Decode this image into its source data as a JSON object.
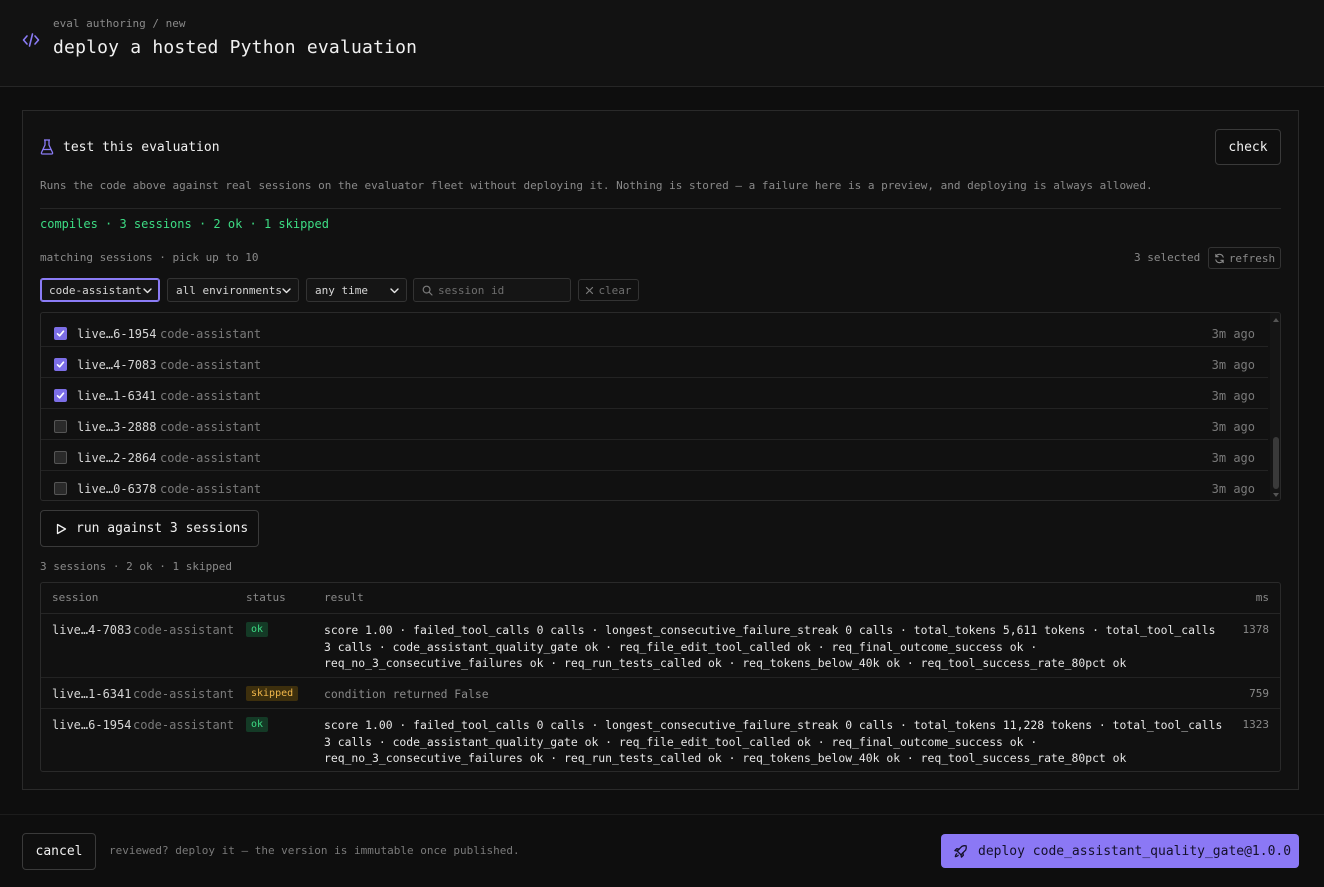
{
  "header": {
    "breadcrumb": "eval authoring / new",
    "title": "deploy a hosted Python evaluation"
  },
  "test_panel": {
    "title": "test this evaluation",
    "check_label": "check",
    "description": "Runs the code above against real sessions on the evaluator fleet without deploying it. Nothing is stored — a failure here is a preview, and deploying is always allowed.",
    "compile_status": "compiles · 3 sessions · 2 ok · 1 skipped"
  },
  "session_picker": {
    "label": "matching sessions · pick up to 10",
    "selected_count": "3 selected",
    "refresh_label": "refresh",
    "filters": {
      "agent": "code-assistant",
      "environment": "all environments",
      "time": "any time",
      "search_placeholder": "session id",
      "clear_label": "clear"
    },
    "sessions": [
      {
        "id": "live…6-1954",
        "env": "code-assistant",
        "age": "3m ago",
        "checked": true
      },
      {
        "id": "live…4-7083",
        "env": "code-assistant",
        "age": "3m ago",
        "checked": true
      },
      {
        "id": "live…1-6341",
        "env": "code-assistant",
        "age": "3m ago",
        "checked": true
      },
      {
        "id": "live…3-2888",
        "env": "code-assistant",
        "age": "3m ago",
        "checked": false
      },
      {
        "id": "live…2-2864",
        "env": "code-assistant",
        "age": "3m ago",
        "checked": false
      },
      {
        "id": "live…0-6378",
        "env": "code-assistant",
        "age": "3m ago",
        "checked": false
      }
    ]
  },
  "run": {
    "label": "run against 3 sessions",
    "summary": "3 sessions · 2 ok · 1 skipped"
  },
  "results": {
    "columns": {
      "session": "session",
      "status": "status",
      "result": "result",
      "ms": "ms"
    },
    "rows": [
      {
        "id": "live…4-7083",
        "env": "code-assistant",
        "status": "ok",
        "result": "score 1.00 · failed_tool_calls 0 calls · longest_consecutive_failure_streak 0 calls · total_tokens 5,611 tokens · total_tool_calls 3 calls · code_assistant_quality_gate ok · req_file_edit_tool_called ok · req_final_outcome_success ok · req_no_3_consecutive_failures ok · req_run_tests_called ok · req_tokens_below_40k ok · req_tool_success_rate_80pct ok",
        "ms": "1378"
      },
      {
        "id": "live…1-6341",
        "env": "code-assistant",
        "status": "skipped",
        "result": "condition returned False",
        "ms": "759"
      },
      {
        "id": "live…6-1954",
        "env": "code-assistant",
        "status": "ok",
        "result": "score 1.00 · failed_tool_calls 0 calls · longest_consecutive_failure_streak 0 calls · total_tokens 11,228 tokens · total_tool_calls 3 calls · code_assistant_quality_gate ok · req_file_edit_tool_called ok · req_final_outcome_success ok · req_no_3_consecutive_failures ok · req_run_tests_called ok · req_tokens_below_40k ok · req_tool_success_rate_80pct ok",
        "ms": "1323"
      }
    ]
  },
  "footer": {
    "cancel_label": "cancel",
    "note": "reviewed? deploy it — the version is immutable once published.",
    "deploy_label": "deploy code_assistant_quality_gate@1.0.0"
  },
  "colors": {
    "accent": "#8b78f5",
    "ok": "#3ddc84",
    "skipped": "#f2b84b",
    "background": "#0e0e0e"
  },
  "icons": {
    "header": "code-icon",
    "panel": "flask-icon",
    "refresh": "refresh-icon",
    "search": "search-icon",
    "clear": "close-icon",
    "run": "play-icon",
    "deploy": "rocket-icon"
  }
}
